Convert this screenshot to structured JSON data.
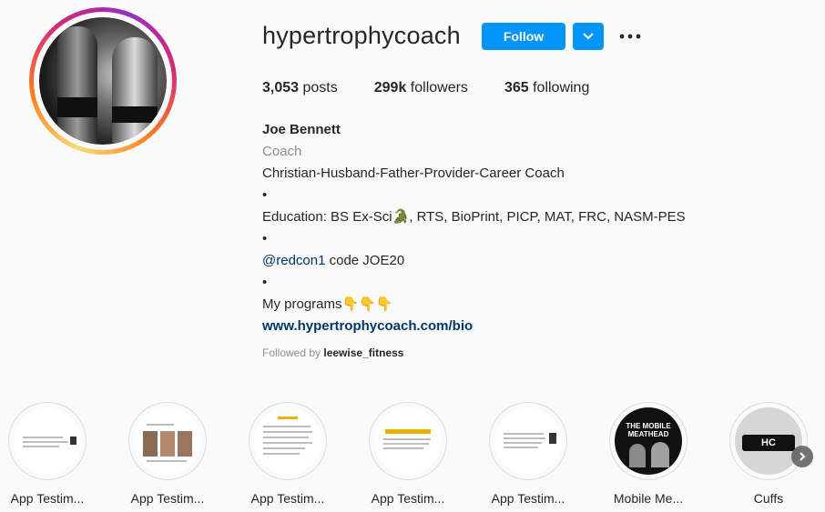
{
  "profile": {
    "username": "hypertrophycoach",
    "follow_label": "Follow",
    "posts_count": "3,053",
    "posts_label": "posts",
    "followers_count": "299k",
    "followers_label": "followers",
    "following_count": "365",
    "following_label": "following"
  },
  "bio": {
    "name": "Joe Bennett",
    "category": "Coach",
    "line1": "Christian-Husband-Father-Provider-Career Coach",
    "bullet": "•",
    "education": "Education: BS Ex-Sci🐊, RTS, BioPrint, PICP, MAT, FRC, NASM-PES",
    "mention": "@redcon1",
    "mention_rest": " code JOE20",
    "programs": "My programs👇👇👇",
    "link": "www.hypertrophycoach.com/bio"
  },
  "followed_by": {
    "prefix": "Followed by ",
    "user": "leewise_fitness"
  },
  "highlights": [
    {
      "label": "App Testim..."
    },
    {
      "label": "App Testim..."
    },
    {
      "label": "App Testim..."
    },
    {
      "label": "App Testim..."
    },
    {
      "label": "App Testim..."
    },
    {
      "label": "Mobile Me..."
    },
    {
      "label": "Cuffs"
    }
  ],
  "highlight_text": {
    "mobile_title": "THE MOBILE MEATHEAD",
    "cuffs_logo": "HC"
  },
  "colors": {
    "accent": "#0095f6",
    "link": "#00376b",
    "muted": "#8e8e8e"
  },
  "icons": [
    "chevron-down-icon",
    "more-options-icon",
    "chevron-right-icon"
  ]
}
